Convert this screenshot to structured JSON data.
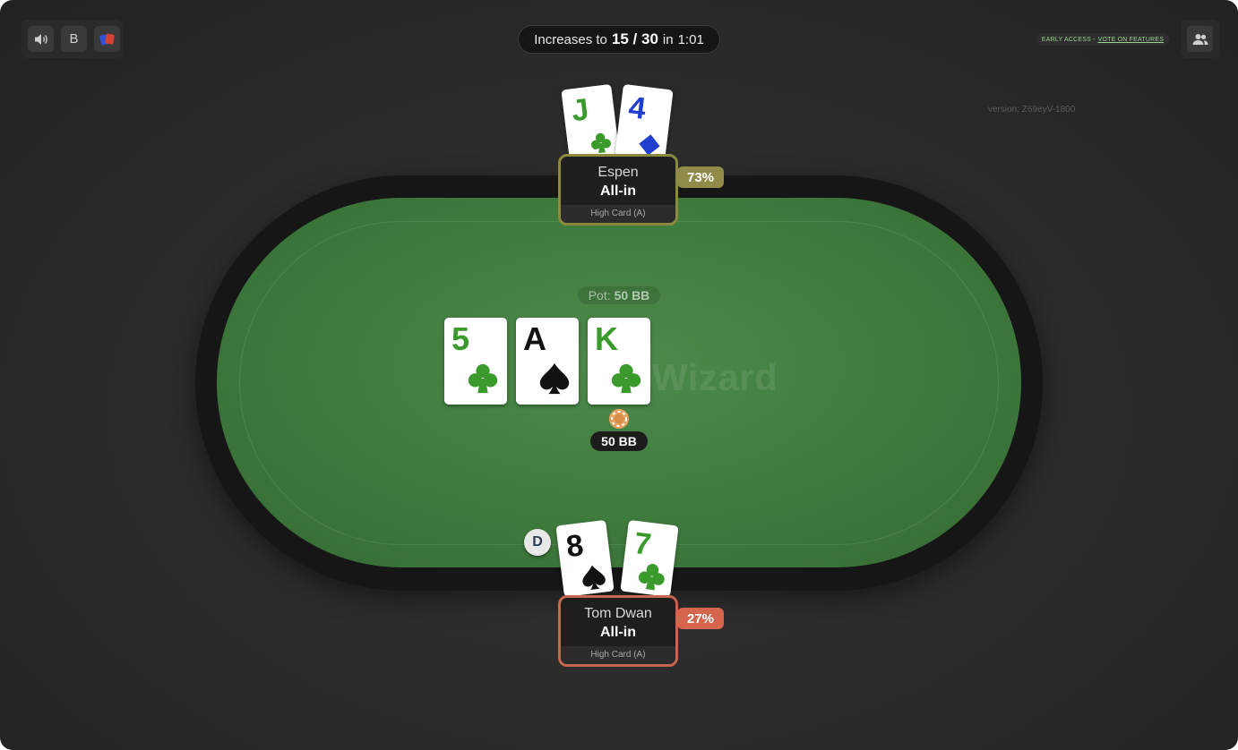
{
  "toolbar": {
    "sound_icon": "speaker-icon",
    "board_label": "B",
    "deck_icon": "four-color-deck-icon"
  },
  "timer": {
    "prefix": "Increases to",
    "blinds": "15 / 30",
    "in_label": "in",
    "time": "1:01"
  },
  "early_access": {
    "label": "EARLY ACCESS -",
    "link": "VOTE ON FEATURES"
  },
  "users_icon": "users-icon",
  "version": "version: Z69eyV-1800",
  "watermark": "Wizard",
  "pot": {
    "label": "Pot:",
    "value": "50 BB"
  },
  "board": [
    {
      "rank": "5",
      "suit": "clubs",
      "color": "#3a9a2c"
    },
    {
      "rank": "A",
      "suit": "spades",
      "color": "#111111"
    },
    {
      "rank": "K",
      "suit": "clubs",
      "color": "#3a9a2c"
    }
  ],
  "bet": {
    "chip_color": "#e8a15c",
    "value": "50 BB"
  },
  "players": {
    "top": {
      "name": "Espen",
      "status": "All-in",
      "hand": "High Card (A)",
      "equity": "73%",
      "accent": "#8c8a3e",
      "cards": [
        {
          "rank": "J",
          "suit": "clubs",
          "color": "#3a9a2c"
        },
        {
          "rank": "4",
          "suit": "diamonds",
          "color": "#1f3fcc"
        }
      ]
    },
    "bottom": {
      "name": "Tom Dwan",
      "status": "All-in",
      "hand": "High Card (A)",
      "equity": "27%",
      "accent": "#c6674f",
      "cards": [
        {
          "rank": "8",
          "suit": "spades",
          "color": "#111111"
        },
        {
          "rank": "7",
          "suit": "clubs",
          "color": "#3a9a2c"
        }
      ]
    }
  },
  "dealer_button": "D"
}
